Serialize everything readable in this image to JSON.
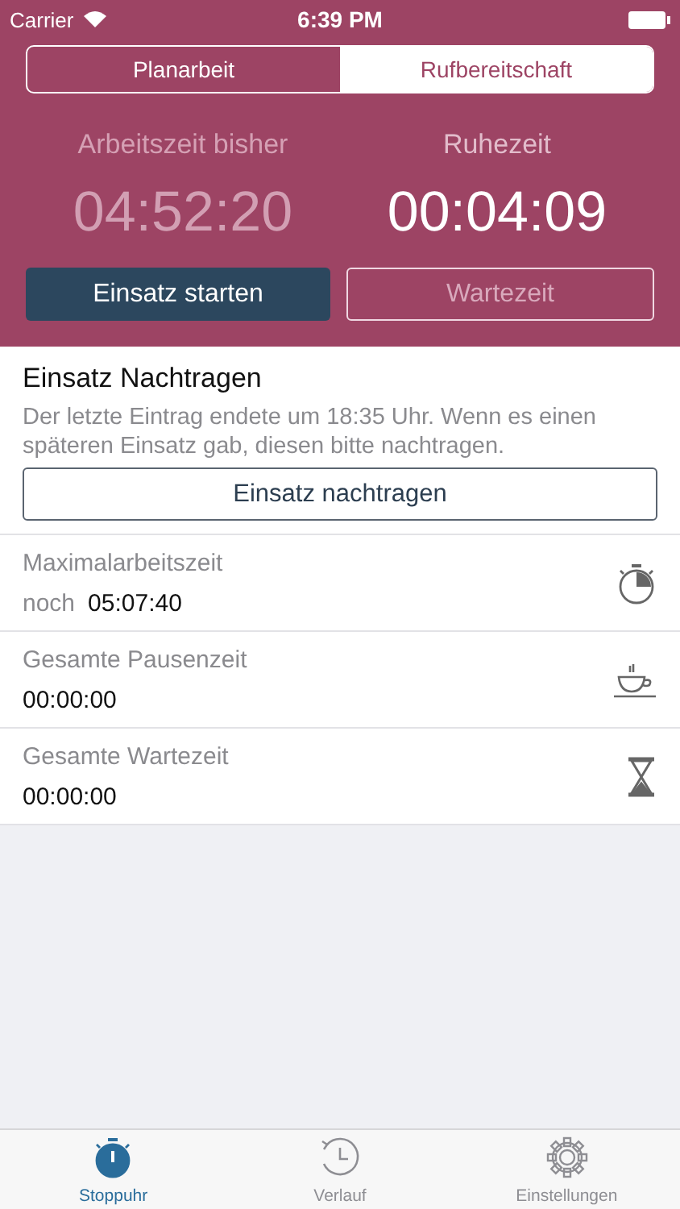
{
  "status_bar": {
    "carrier": "Carrier",
    "time": "6:39 PM"
  },
  "segments": [
    {
      "label": "Planarbeit",
      "selected": false
    },
    {
      "label": "Rufbereitschaft",
      "selected": true
    }
  ],
  "timers": [
    {
      "label": "Arbeitszeit bisher",
      "value": "04:52:20",
      "active": false
    },
    {
      "label": "Ruhezeit",
      "value": "00:04:09",
      "active": true
    }
  ],
  "actions": [
    {
      "label": "Einsatz starten",
      "kind": "filled",
      "disabled": false
    },
    {
      "label": "Wartezeit",
      "kind": "outline",
      "disabled": true
    }
  ],
  "notice": {
    "title": "Einsatz Nachtragen",
    "text": "Der letzte Eintrag endete um 18:35 Uhr. Wenn es einen späteren Einsatz gab, diesen bitte nachtragen.",
    "button": "Einsatz nachtragen"
  },
  "stats": [
    {
      "label": "Maximalarbeitszeit",
      "prefix": "noch",
      "value": "05:07:40",
      "kind": "stopwatch"
    },
    {
      "label": "Gesamte Pausenzeit",
      "value": "00:00:00",
      "kind": "cup"
    },
    {
      "label": "Gesamte Wartezeit",
      "value": "00:00:00",
      "kind": "hourglass"
    }
  ],
  "tab_bar": [
    {
      "label": "Stoppuhr",
      "kind": "stopwatch",
      "selected": true
    },
    {
      "label": "Verlauf",
      "kind": "history",
      "selected": false
    },
    {
      "label": "Einstellungen",
      "kind": "settings",
      "selected": false
    }
  ]
}
